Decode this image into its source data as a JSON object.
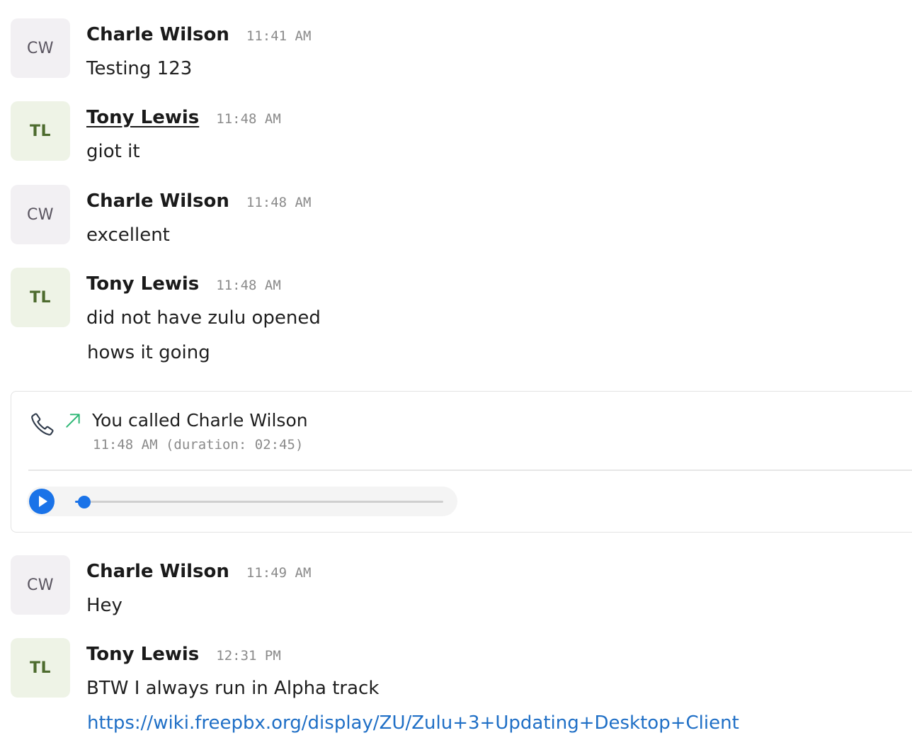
{
  "messages": [
    {
      "avatar": "CW",
      "sender": "Charle Wilson",
      "time": "11:41 AM",
      "lines": [
        "Testing 123"
      ]
    },
    {
      "avatar": "TL",
      "sender": "Tony Lewis",
      "time": "11:48 AM",
      "lines": [
        "giot it"
      ]
    },
    {
      "avatar": "CW",
      "sender": "Charle Wilson",
      "time": "11:48 AM",
      "lines": [
        "excellent"
      ]
    },
    {
      "avatar": "TL",
      "sender": "Tony Lewis",
      "time": "11:48 AM",
      "lines": [
        "did not have zulu opened",
        "hows it going"
      ]
    },
    {
      "avatar": "CW",
      "sender": "Charle Wilson",
      "time": "11:49 AM",
      "lines": [
        "Hey"
      ]
    },
    {
      "avatar": "TL",
      "sender": "Tony Lewis",
      "time": "12:31 PM",
      "lines": [
        "BTW I always run in Alpha track"
      ],
      "link": "https://wiki.freepbx.org/display/ZU/Zulu+3+Updating+Desktop+Client"
    }
  ],
  "call": {
    "title": "You called Charle Wilson",
    "subtitle": "11:48 AM (duration: 02:45)",
    "icon": "phone-icon",
    "direction_icon": "outgoing-arrow-icon",
    "direction_color": "#2bb673",
    "player": {
      "progress": 0.025,
      "accent": "#1a73e8"
    }
  }
}
